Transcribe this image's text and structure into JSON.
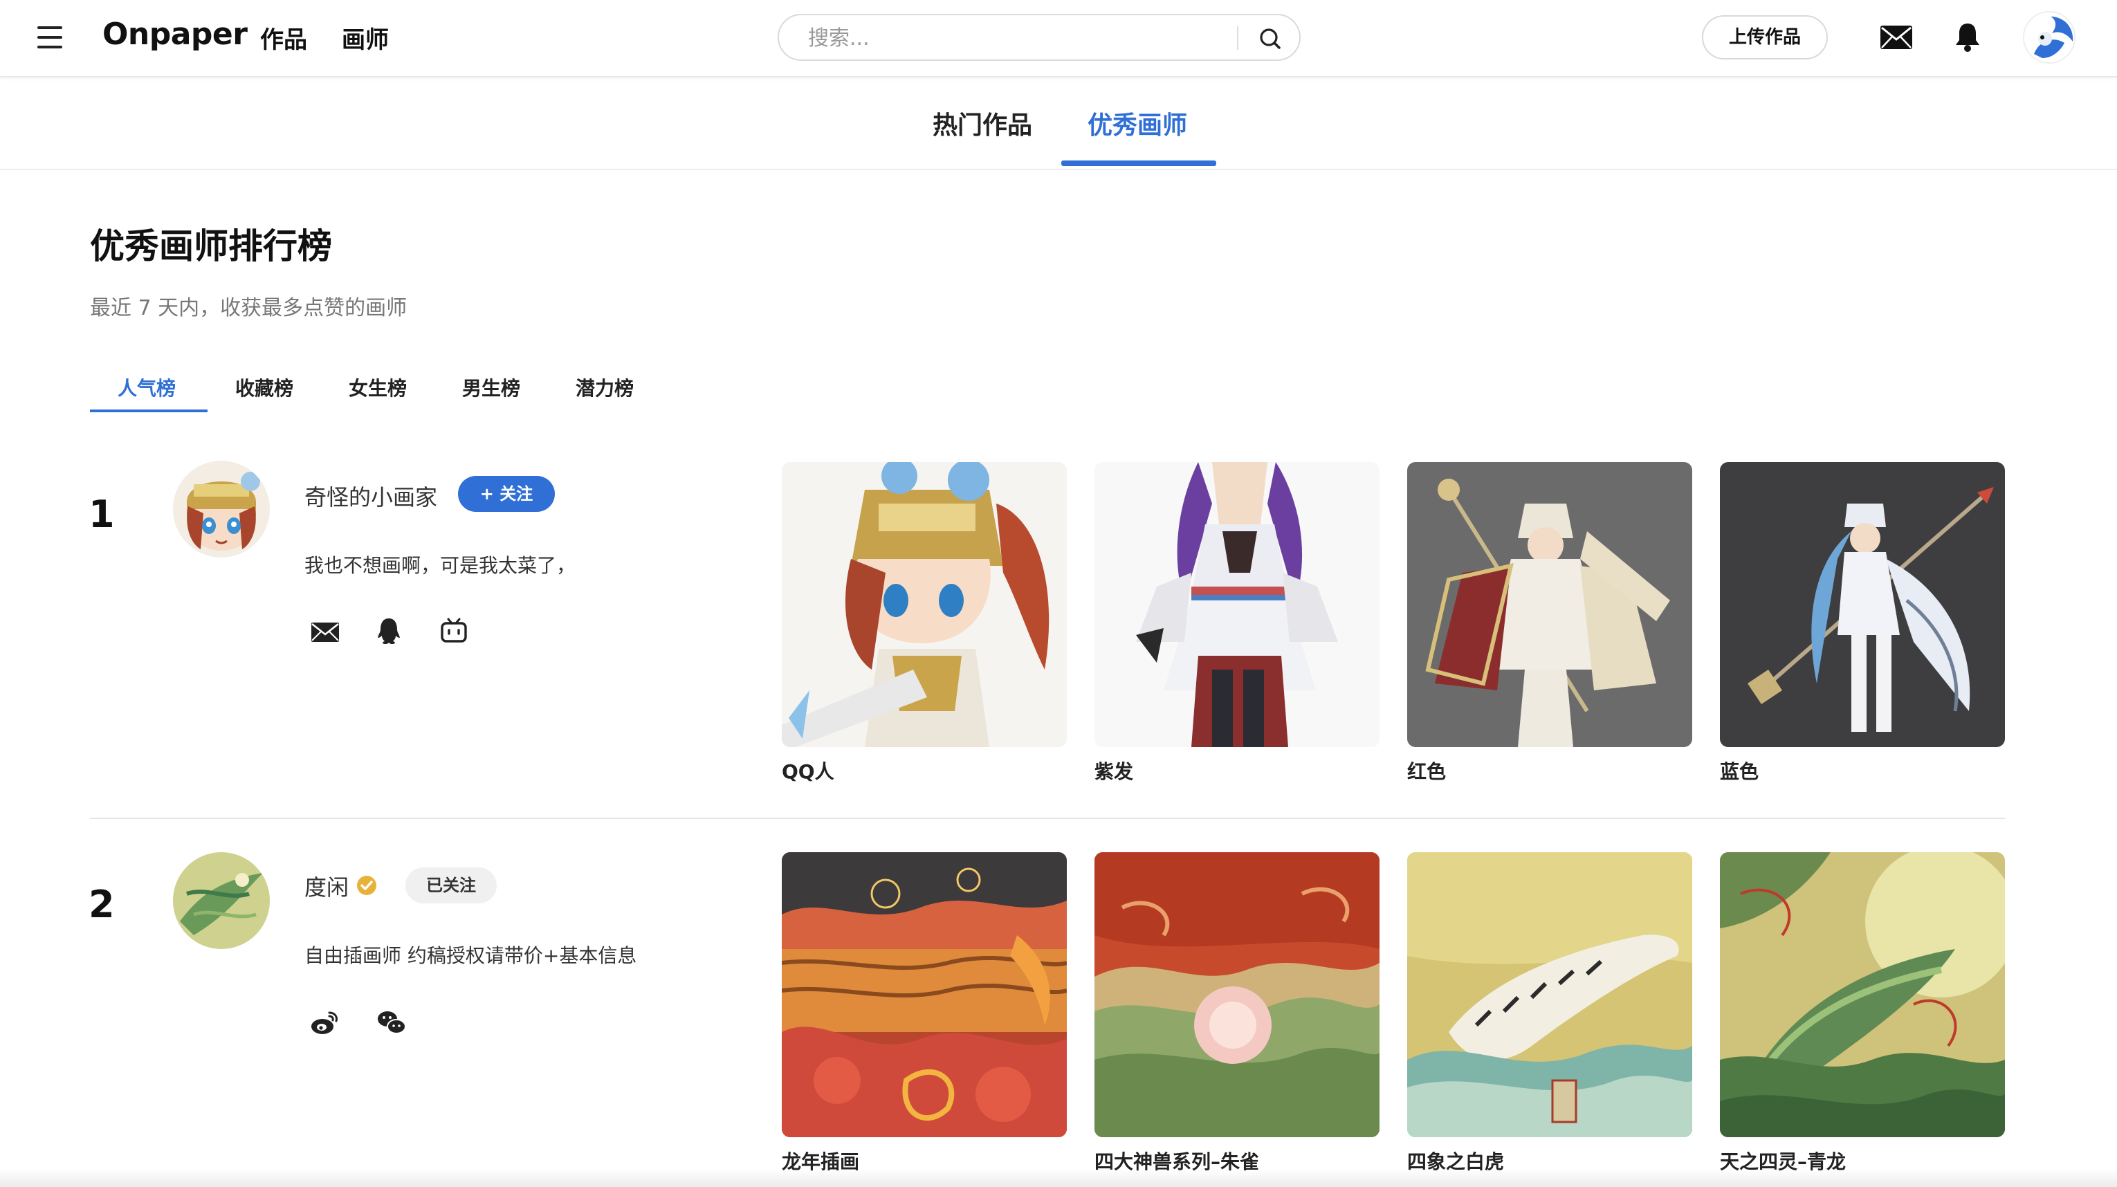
{
  "header": {
    "logo": "Onpaper",
    "nav": {
      "works": "作品",
      "artists": "画师"
    },
    "search_placeholder": "搜索...",
    "upload_label": "上传作品"
  },
  "main_tabs": [
    {
      "label": "热门作品",
      "active": false
    },
    {
      "label": "优秀画师",
      "active": true
    }
  ],
  "section": {
    "title": "优秀画师排行榜",
    "subtitle": "最近 7 天内，收获最多点赞的画师"
  },
  "sub_tabs": [
    {
      "label": "人气榜",
      "active": true
    },
    {
      "label": "收藏榜",
      "active": false
    },
    {
      "label": "女生榜",
      "active": false
    },
    {
      "label": "男生榜",
      "active": false
    },
    {
      "label": "潜力榜",
      "active": false
    }
  ],
  "artists": [
    {
      "rank": "1",
      "name": "奇怪的小画家",
      "verified": false,
      "follow_label": "+ 关注",
      "followed": false,
      "bio": "我也不想画啊，可是我太菜了，",
      "socials": [
        "mail-icon",
        "qq-icon",
        "bilibili-icon"
      ],
      "works": [
        {
          "title": "QQ人"
        },
        {
          "title": "紫发"
        },
        {
          "title": "红色"
        },
        {
          "title": "蓝色"
        }
      ]
    },
    {
      "rank": "2",
      "name": "度闲",
      "verified": true,
      "follow_label": "已关注",
      "followed": true,
      "bio": "自由插画师 约稿授权请带价+基本信息",
      "socials": [
        "weibo-icon",
        "wechat-icon"
      ],
      "works": [
        {
          "title": "龙年插画"
        },
        {
          "title": "四大神兽系列–朱雀"
        },
        {
          "title": "四象之白虎"
        },
        {
          "title": "天之四灵–青龙"
        }
      ]
    }
  ],
  "colors": {
    "accent": "#2f6fd6",
    "verified_badge": "#e8b23a"
  }
}
